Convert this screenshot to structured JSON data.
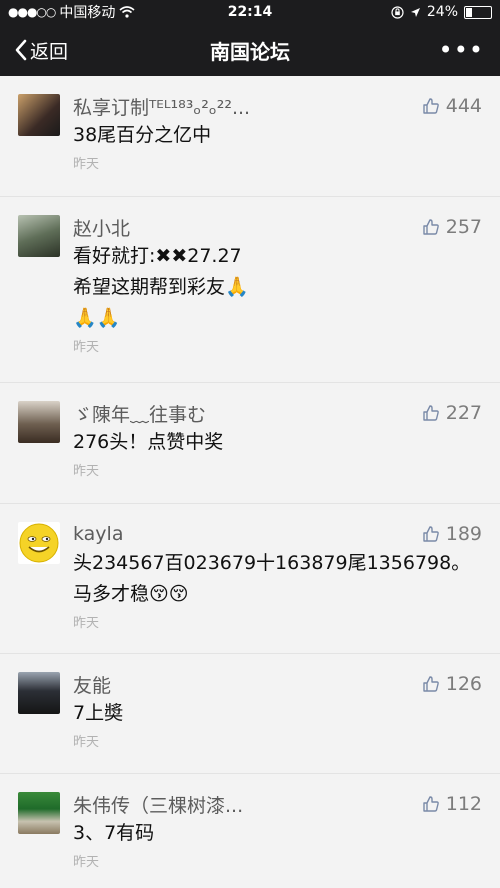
{
  "status": {
    "carrier": "中国移动",
    "time": "22:14",
    "battery": "24%",
    "battery_level": 0.24
  },
  "nav": {
    "back_label": "返回",
    "title": "南国论坛",
    "more_label": "•••"
  },
  "comments": [
    {
      "name": "私享订制ᵀᴱᴸ¹⁸³ₒ²ₒ²²...",
      "likes": "444",
      "text": "38尾百分之亿中",
      "time": "昨天"
    },
    {
      "name": "赵小北",
      "likes": "257",
      "text": "看好就打:✖✖27.27\n希望这期帮到彩友🙏\n🙏🙏",
      "time": "昨天"
    },
    {
      "name": "ゞ陳年﹏往事む",
      "likes": "227",
      "text": "276头！点赞中奖",
      "time": "昨天"
    },
    {
      "name": "kayla",
      "likes": "189",
      "text": "头234567百023679十163879尾1356798。\n马多才稳😚😚",
      "time": "昨天"
    },
    {
      "name": "友能",
      "likes": "126",
      "text": "7上奬",
      "time": "昨天"
    },
    {
      "name": "朱伟传（三棵树漆...",
      "likes": "112",
      "text": "3、7有码",
      "time": "昨天"
    }
  ],
  "icons": {
    "back": "chevron-left-icon",
    "like": "thumbs-up-icon",
    "wifi": "wifi-icon",
    "lock": "orientation-lock-icon",
    "location": "location-arrow-icon",
    "battery": "battery-icon"
  }
}
